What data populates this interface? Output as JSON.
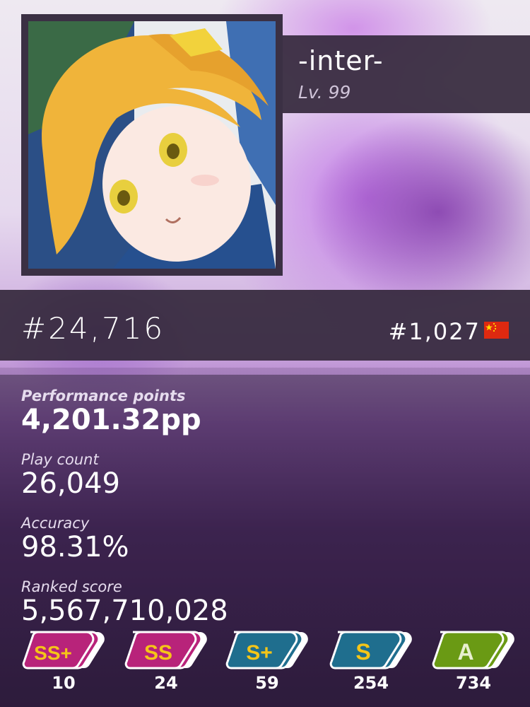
{
  "profile": {
    "username": "-inter-",
    "level": "Lv. 99"
  },
  "rank": {
    "global": "#24,716",
    "country": "#1,027",
    "country_flag": "china-flag"
  },
  "stats": {
    "pp_label": "Performance points",
    "pp_value": "4,201.32pp",
    "playcount_label": "Play count",
    "playcount_value": "26,049",
    "accuracy_label": "Accuracy",
    "accuracy_value": "98.31%",
    "ranked_score_label": "Ranked score",
    "ranked_score_value": "5,567,710,028"
  },
  "grades": [
    {
      "icon": "grade-ssh-icon",
      "letter": "SS+",
      "color": "#b8237a",
      "count": "10"
    },
    {
      "icon": "grade-ss-icon",
      "letter": "SS",
      "color": "#b8237a",
      "count": "24"
    },
    {
      "icon": "grade-sh-icon",
      "letter": "S+",
      "color": "#1f6e8e",
      "count": "59"
    },
    {
      "icon": "grade-s-icon",
      "letter": "S",
      "color": "#1f6e8e",
      "count": "254"
    },
    {
      "icon": "grade-a-icon",
      "letter": "A",
      "color": "#6a9a14",
      "count": "734"
    }
  ],
  "colors": {
    "panel": "#34283c",
    "grade_letter_gold": "#f5c518",
    "flag_red": "#de2910"
  }
}
